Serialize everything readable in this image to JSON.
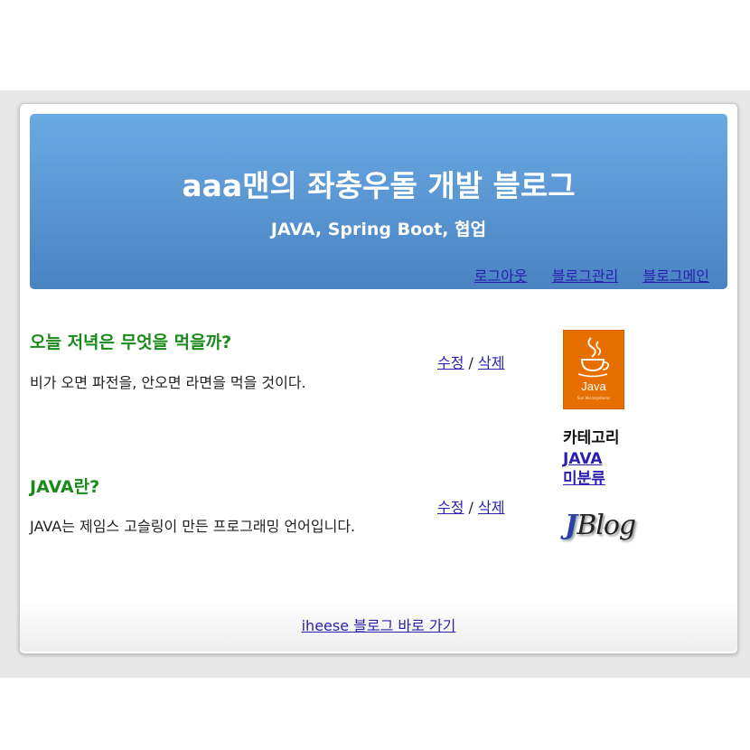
{
  "header": {
    "title": "aaa맨의 좌충우돌 개발 블로그",
    "subtitle": "JAVA, Spring Boot, 협업",
    "nav": {
      "logout": "로그아웃",
      "admin": "블로그관리",
      "main": "블로그메인"
    }
  },
  "posts": [
    {
      "title": "오늘 저녁은 무엇을 먹을까?",
      "body": "비가 오면 파전을, 안오면 라면을 먹을 것이다.",
      "edit": "수정",
      "separator": "/",
      "delete": "삭제"
    },
    {
      "title": "JAVA란?",
      "body": "JAVA는 제임스 고슬링이 만든 프로그래밍 언어입니다.",
      "edit": "수정",
      "separator": "/",
      "delete": "삭제"
    }
  ],
  "sidebar": {
    "logo_text": "Java",
    "logo_subtext": "Sun Microsystems",
    "category_header": "카테고리",
    "categories": [
      "JAVA",
      "미분류"
    ],
    "brand_logo": {
      "j": "J",
      "rest": "Blog"
    }
  },
  "footer": {
    "link": "iheese 블로그 바로 가기"
  },
  "colors": {
    "header_gradient_top": "#6aaae3",
    "header_gradient_bottom": "#4a83c2",
    "post_title": "#1a8a1a",
    "link": "#2a1fae",
    "java_logo_bg": "#e76f00"
  }
}
